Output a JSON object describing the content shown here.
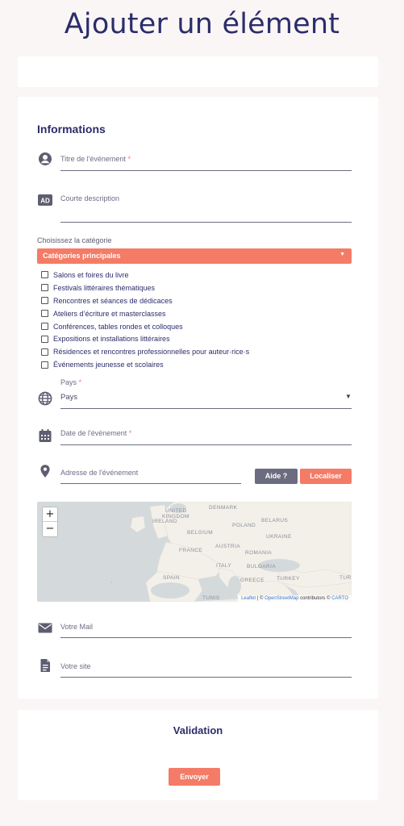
{
  "page": {
    "title": "Ajouter un élément"
  },
  "info": {
    "section_title": "Informations",
    "title_field": {
      "label": "Titre de l'événement",
      "required_mark": "*"
    },
    "description_field": {
      "label": "Courte description",
      "icon_text": "AD"
    },
    "category": {
      "label": "Choisissez la catégorie",
      "select_value": "Catégories principales",
      "options": [
        "Salons et foires du livre",
        "Festivals littéraires thématiques",
        "Rencontres et séances de dédicaces",
        "Ateliers d’écriture et masterclasses",
        "Conférences, tables rondes et colloques",
        "Expositions et installations littéraires",
        "Résidences et rencontres professionnelles pour auteur·rice·s",
        "Événements jeunesse et scolaires"
      ]
    },
    "country_field": {
      "label": "Pays",
      "required_mark": "*",
      "value": "Pays"
    },
    "date_field": {
      "label": "Date de l'événement",
      "required_mark": "*"
    },
    "address_field": {
      "label": "Adresse de l'événement"
    },
    "help_button": "Aide ?",
    "locate_button": "Localiser",
    "map": {
      "zoom_in": "+",
      "zoom_out": "−",
      "labels": {
        "denmark": "DENMARK",
        "united_kingdom_1": "UNITED",
        "united_kingdom_2": "KINGDOM",
        "ireland": "IRELAND",
        "belarus": "BELARUS",
        "poland": "POLAND",
        "belgium": "BELGIUM",
        "ukraine": "UKRAINE",
        "france": "FRANCE",
        "austria": "AUSTRIA",
        "romania": "ROMANIA",
        "italy": "ITALY",
        "bulgaria": "BULGARIA",
        "spain": "SPAIN",
        "greece": "GREECE",
        "turkey": "TURKEY",
        "tunisia": "TUNIS",
        "tur_cut": "TUR"
      },
      "attribution": {
        "leaflet": "Leaflet",
        "sep": " | © ",
        "osm": "OpenStreetMap",
        "contrib": " contributors © ",
        "carto": "CARTO"
      }
    },
    "mail_field": {
      "label": "Votre Mail"
    },
    "site_field": {
      "label": "Votre site"
    }
  },
  "validation": {
    "title": "Validation",
    "send_button": "Envoyer"
  },
  "colors": {
    "accent": "#f47c66",
    "navy": "#2b2d6b",
    "gray_button": "#6c6c80"
  }
}
